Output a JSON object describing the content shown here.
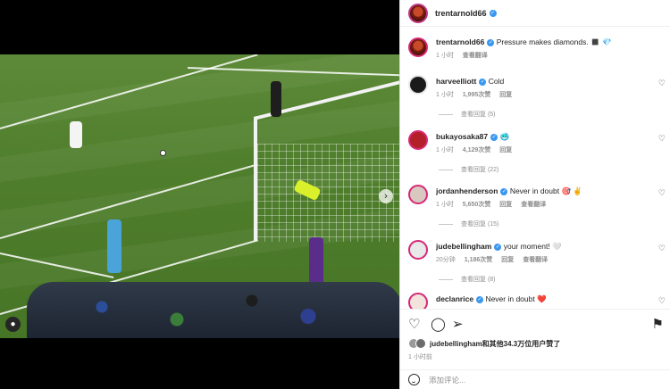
{
  "post": {
    "author": "trentarnold66",
    "author_verified": true
  },
  "caption": {
    "author": "trentarnold66",
    "text": "Pressure makes diamonds. ◼️ 💎",
    "time": "1 小时",
    "translate": "查看翻译"
  },
  "comments": [
    {
      "user": "harveelliott",
      "text": "Cold",
      "time": "1 小时",
      "likes": "1,995次赞",
      "reply": "回复",
      "translate": "",
      "replies": "查看回复 (5)",
      "avatar_color": "#1a1a1a"
    },
    {
      "user": "bukayosaka87",
      "text": "🥶",
      "time": "1 小时",
      "likes": "4,129次赞",
      "reply": "回复",
      "translate": "",
      "replies": "查看回复 (22)",
      "avatar_color": "#b3202a"
    },
    {
      "user": "jordanhenderson",
      "text": "Never in doubt 🎯 ✌️",
      "time": "1 小时",
      "likes": "5,650次赞",
      "reply": "回复",
      "translate": "查看翻译",
      "replies": "查看回复 (15)",
      "avatar_color": "#d8c8c0"
    },
    {
      "user": "judebellingham",
      "text": "your moment! 🤍",
      "time": "20分钟",
      "likes": "1,186次赞",
      "reply": "回复",
      "translate": "查看翻译",
      "replies": "查看回复 (8)",
      "avatar_color": "#e8e8e8"
    },
    {
      "user": "declanrice",
      "text": "Never in doubt ❤️",
      "time": "",
      "likes": "",
      "reply": "",
      "translate": "",
      "replies": "",
      "avatar_color": "#f2e3dc"
    }
  ],
  "likes_line": {
    "user": "judebellingham",
    "rest": "和其他34.3万位用户赞了"
  },
  "post_time": "1 小时前",
  "comment_box": {
    "placeholder": "添加评论..."
  },
  "icons": {
    "like": "heart-icon",
    "comment": "comment-icon",
    "share": "share-icon",
    "save": "bookmark-icon",
    "next": "chevron-right-icon",
    "tag": "user-tag-icon"
  }
}
